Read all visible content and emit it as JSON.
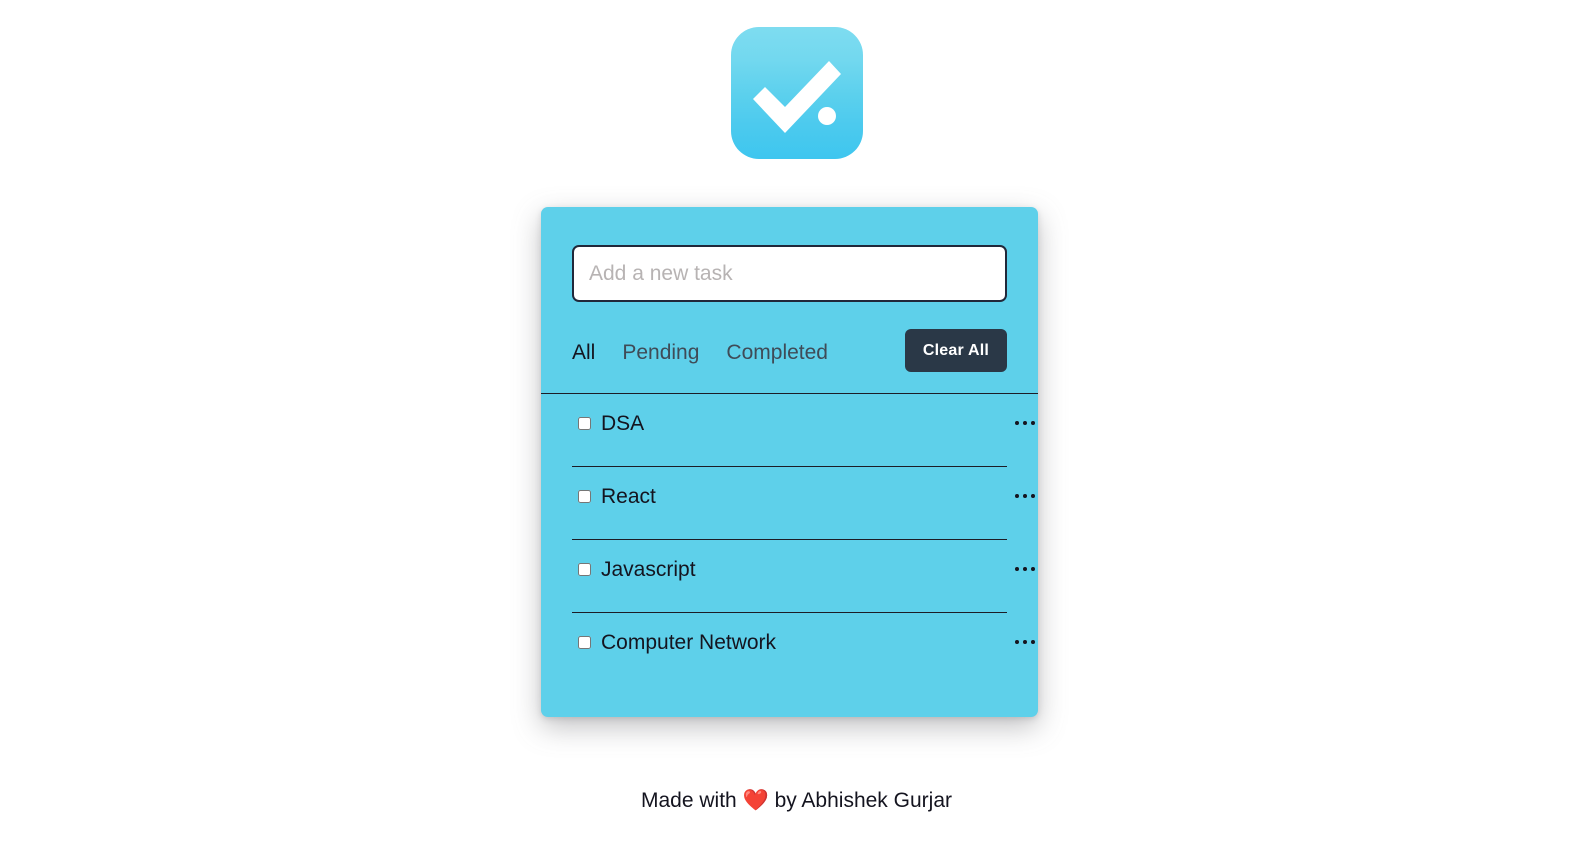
{
  "theme": {
    "page_bg": "#ffffff",
    "card_bg": "#5ed0ea",
    "accent_dark": "#2a3847",
    "text_dark": "#14141f",
    "placeholder": "#b7b3b3",
    "logo_gradient_top": "#7edcf0",
    "logo_gradient_bottom": "#3ec6ef",
    "heart": "#e8383d"
  },
  "logo": {
    "icon": "check-circle-dot-icon",
    "alt": "Todo app logo"
  },
  "input": {
    "name": "new-task-input",
    "value": "",
    "placeholder": "Add a new task"
  },
  "filters": [
    {
      "label": "All",
      "active": true
    },
    {
      "label": "Pending",
      "active": false
    },
    {
      "label": "Completed",
      "active": false
    }
  ],
  "clear_all": {
    "label": "Clear All"
  },
  "tasks": [
    {
      "label": "DSA",
      "completed": false,
      "menu_icon": "ellipsis-icon"
    },
    {
      "label": "React",
      "completed": false,
      "menu_icon": "ellipsis-icon"
    },
    {
      "label": "Javascript",
      "completed": false,
      "menu_icon": "ellipsis-icon"
    },
    {
      "label": "Computer Network",
      "completed": false,
      "menu_icon": "ellipsis-icon"
    }
  ],
  "footer": {
    "prefix": "Made with",
    "heart": "❤️",
    "suffix": "by Abhishek Gurjar"
  }
}
